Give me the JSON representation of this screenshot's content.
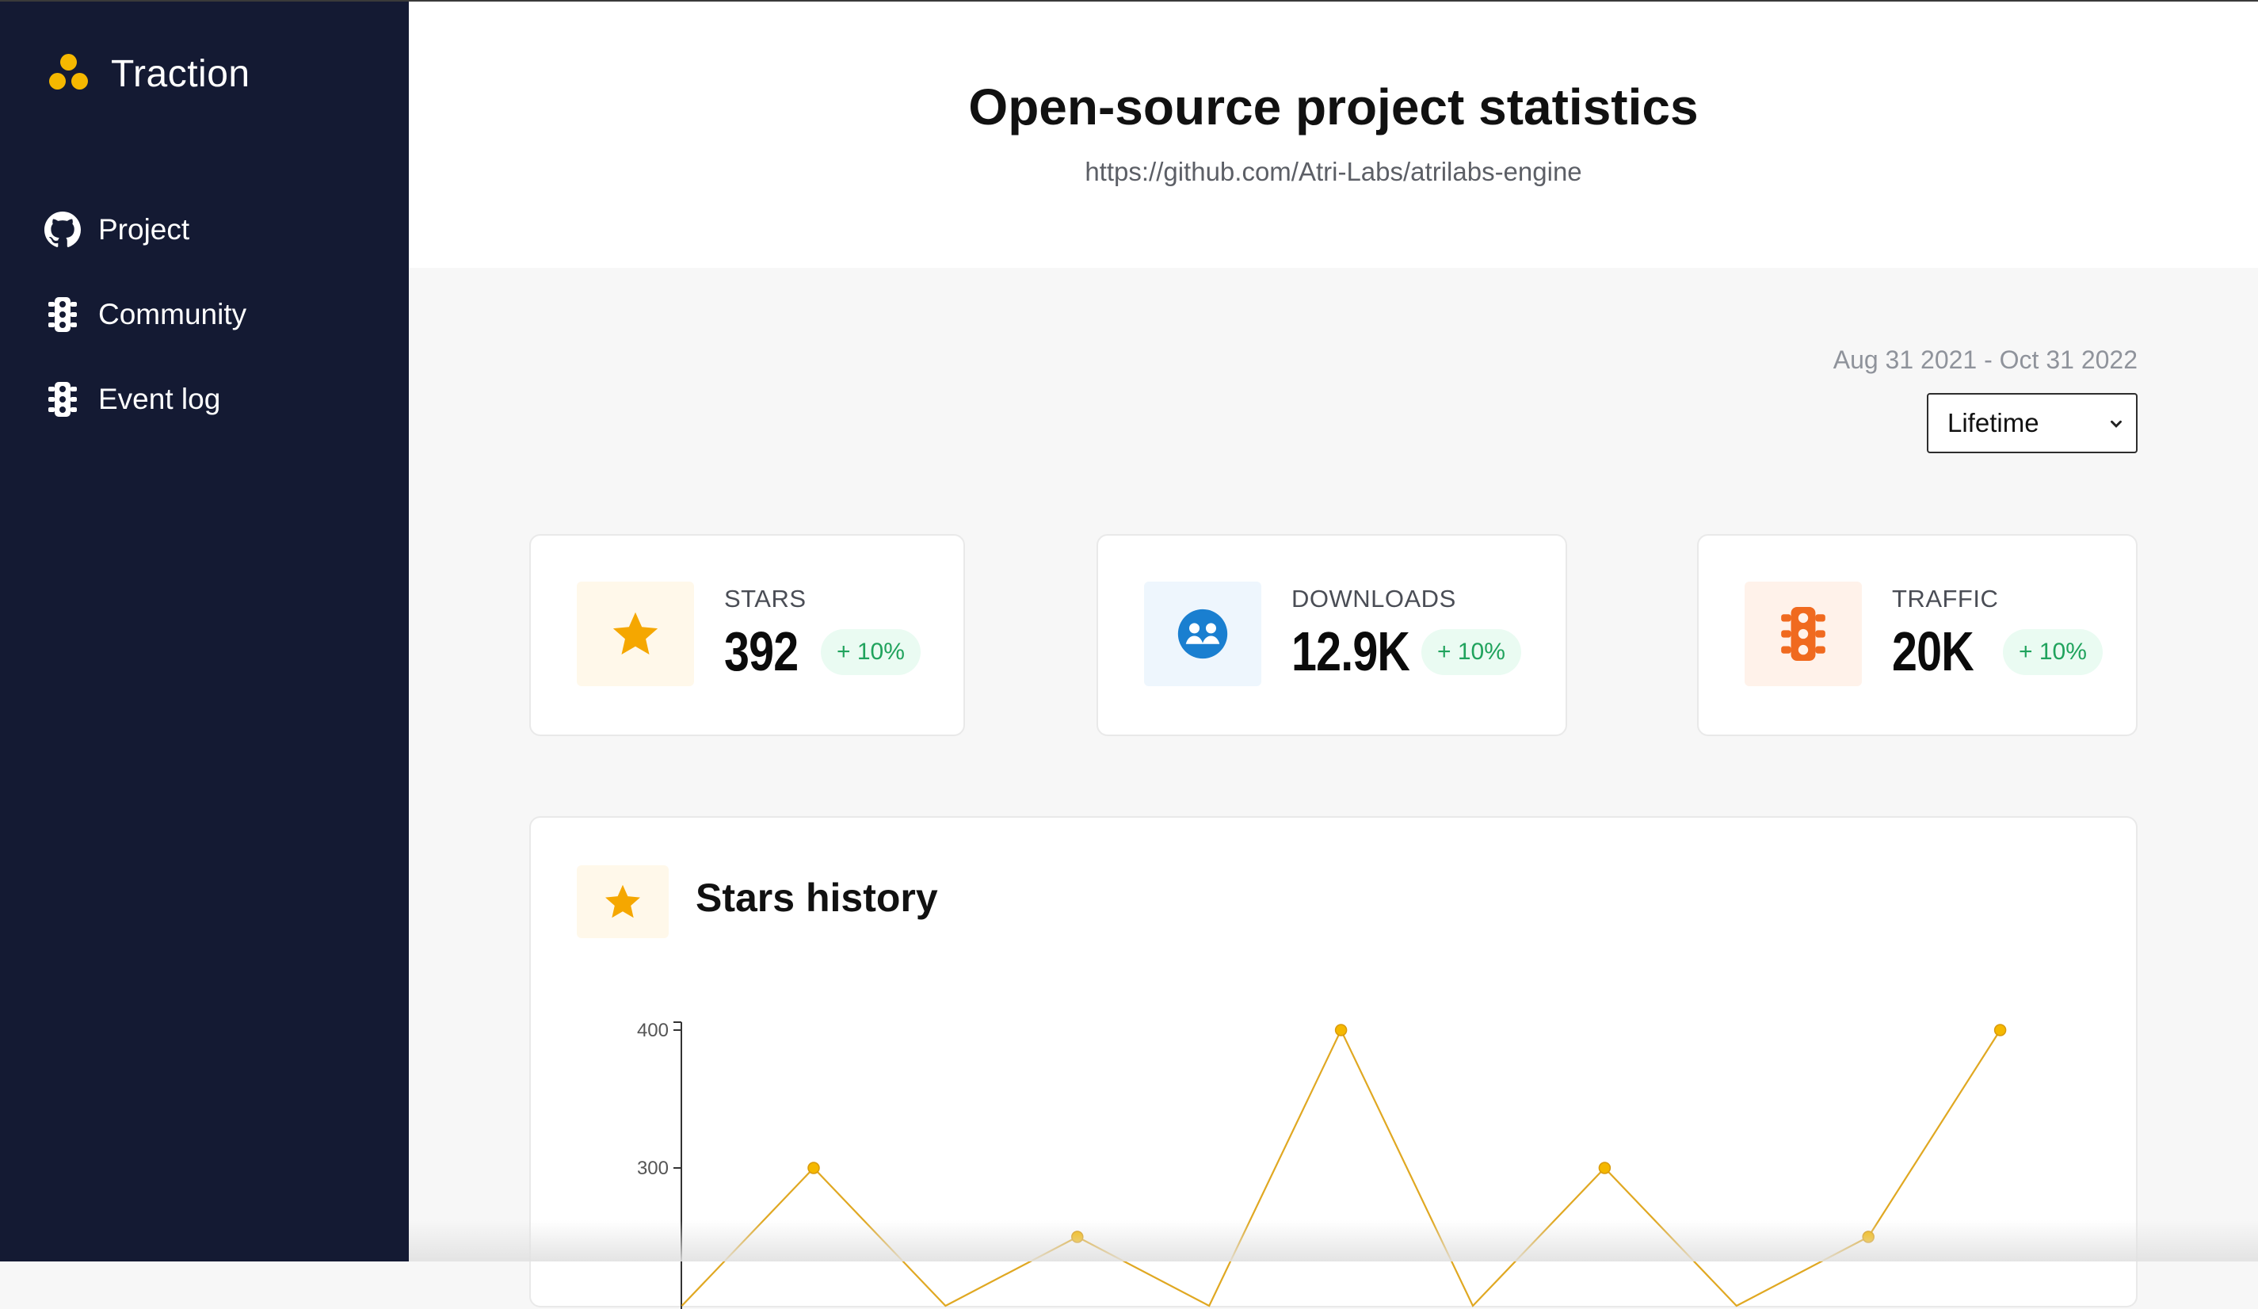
{
  "app": {
    "name": "Traction"
  },
  "sidebar": {
    "items": [
      {
        "label": "Project",
        "icon": "github-icon"
      },
      {
        "label": "Community",
        "icon": "traffic-light-icon"
      },
      {
        "label": "Event log",
        "icon": "traffic-light-icon"
      }
    ]
  },
  "header": {
    "title": "Open-source project statistics",
    "url": "https://github.com/Atri-Labs/atrilabs-engine"
  },
  "filters": {
    "date_range": "Aug 31 2021 - Oct 31 2022",
    "period": "Lifetime"
  },
  "stats": [
    {
      "label": "STARS",
      "value": "392",
      "change": "+ 10%",
      "icon": "star-icon",
      "color": "#f5a700"
    },
    {
      "label": "DOWNLOADS",
      "value": "12.9K",
      "change": "+ 10%",
      "icon": "community-icon",
      "color": "#1a7fd0"
    },
    {
      "label": "TRAFFIC",
      "value": "20K",
      "change": "+ 10%",
      "icon": "traffic-light-icon",
      "color": "#f06a1f"
    }
  ],
  "colors": {
    "sidebar_bg": "#141a33",
    "accent": "#f5b800",
    "badge_text": "#20a35d",
    "badge_bg": "#eafbf2",
    "line": "#e0a822"
  },
  "chart": {
    "title": "Stars history",
    "icon": "star-icon"
  },
  "chart_data": {
    "type": "line",
    "title": "Stars history",
    "xlabel": "",
    "ylabel": "",
    "y_ticks": [
      300,
      400
    ],
    "ylim": [
      200,
      400
    ],
    "grid": false,
    "series": [
      {
        "values": [
          200,
          300,
          200,
          250,
          200,
          400,
          200,
          300,
          200,
          250,
          400
        ]
      }
    ]
  }
}
